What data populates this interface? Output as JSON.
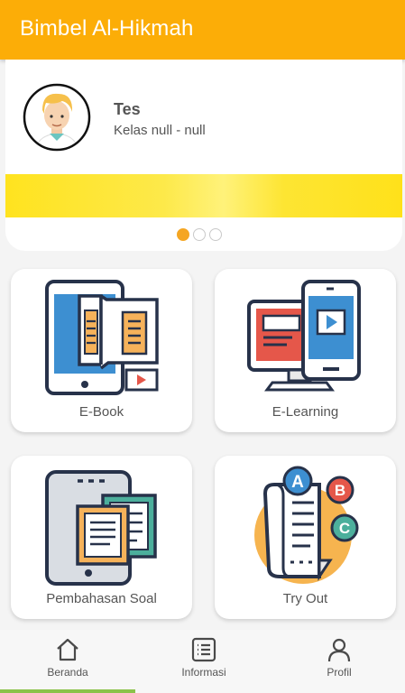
{
  "appbar": {
    "title": "Bimbel Al-Hikmah"
  },
  "profile": {
    "name": "Tes",
    "class_info": "Kelas null - null"
  },
  "carousel": {
    "page_count": 3,
    "active_index": 0
  },
  "menu": [
    {
      "label": "E-Book",
      "icon": "ebook-icon"
    },
    {
      "label": "E-Learning",
      "icon": "elearning-icon"
    },
    {
      "label": "Pembahasan Soal",
      "icon": "pembahasan-soal-icon"
    },
    {
      "label": "Try Out",
      "icon": "try-out-icon"
    }
  ],
  "bottom_nav": {
    "items": [
      {
        "label": "Beranda",
        "icon": "home-icon"
      },
      {
        "label": "Informasi",
        "icon": "list-icon"
      },
      {
        "label": "Profil",
        "icon": "person-icon"
      }
    ],
    "active_index": 0
  },
  "colors": {
    "primary": "#fcad07",
    "indicator": "#8bc34a",
    "dot_active": "#f5a623"
  }
}
